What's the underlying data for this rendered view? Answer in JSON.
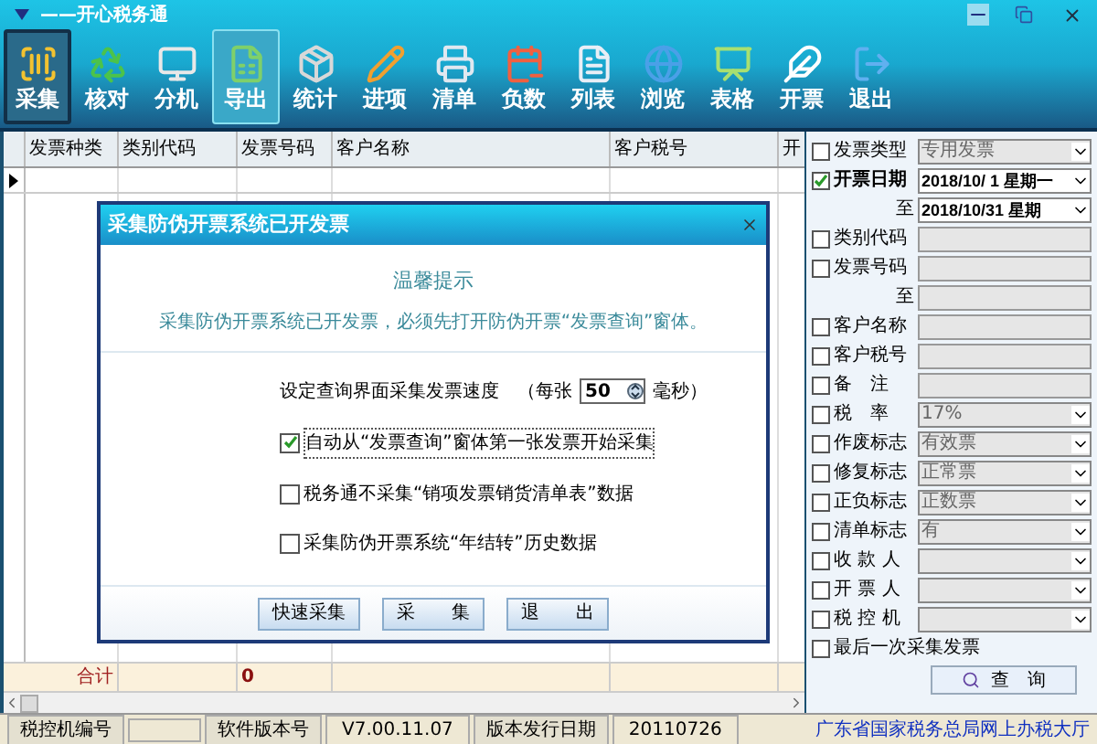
{
  "window": {
    "title": "——开心税务通"
  },
  "toolbar": [
    {
      "label": "采集",
      "selected": true,
      "hovered": false
    },
    {
      "label": "核对",
      "selected": false,
      "hovered": false
    },
    {
      "label": "分机",
      "selected": false,
      "hovered": false
    },
    {
      "label": "导出",
      "selected": false,
      "hovered": true
    },
    {
      "label": "统计",
      "selected": false,
      "hovered": false
    },
    {
      "label": "进项",
      "selected": false,
      "hovered": false
    },
    {
      "label": "清单",
      "selected": false,
      "hovered": false
    },
    {
      "label": "负数",
      "selected": false,
      "hovered": false
    },
    {
      "label": "列表",
      "selected": false,
      "hovered": false
    },
    {
      "label": "浏览",
      "selected": false,
      "hovered": false
    },
    {
      "label": "表格",
      "selected": false,
      "hovered": false
    },
    {
      "label": "开票",
      "selected": false,
      "hovered": false
    },
    {
      "label": "退出",
      "selected": false,
      "hovered": false
    }
  ],
  "table": {
    "columns": [
      "发票种类",
      "类别代码",
      "发票号码",
      "客户名称",
      "客户税号",
      "开"
    ],
    "totals": {
      "label": "合计",
      "count": "0"
    }
  },
  "dialog": {
    "title": "采集防伪开票系统已开发票",
    "heading": "温馨提示",
    "message": "采集防伪开票系统已开发票，必须先打开防伪开票“发票查询”窗体。",
    "speed": {
      "label": "设定查询界面采集发票速度",
      "before": "（每张",
      "value": "50",
      "after": "毫秒）"
    },
    "options": [
      {
        "label": "自动从“发票查询”窗体第一张发票开始采集",
        "checked": true
      },
      {
        "label": "税务通不采集“销项发票销货清单表”数据",
        "checked": false
      },
      {
        "label": "采集防伪开票系统“年结转”历史数据",
        "checked": false
      }
    ],
    "buttons": [
      "快速采集",
      "采　　集",
      "退　　出"
    ]
  },
  "filters": [
    {
      "kind": "dropdown",
      "label": "发票类型",
      "checked": false,
      "value": "专用发票"
    },
    {
      "kind": "date",
      "label": "开票日期",
      "checked": true,
      "value": "2018/10/ 1 星期一"
    },
    {
      "kind": "date",
      "label": "至",
      "value": "2018/10/31 星期"
    },
    {
      "kind": "text",
      "label": "类别代码",
      "checked": false
    },
    {
      "kind": "text",
      "label": "发票号码",
      "checked": false
    },
    {
      "kind": "text",
      "label": "至"
    },
    {
      "kind": "text",
      "label": "客户名称",
      "checked": false
    },
    {
      "kind": "text",
      "label": "客户税号",
      "checked": false
    },
    {
      "kind": "text",
      "label": "备　注",
      "checked": false
    },
    {
      "kind": "dropdown",
      "label": "税　率",
      "checked": false,
      "value": "17%"
    },
    {
      "kind": "dropdown",
      "label": "作废标志",
      "checked": false,
      "value": "有效票"
    },
    {
      "kind": "dropdown",
      "label": "修复标志",
      "checked": false,
      "value": "正常票"
    },
    {
      "kind": "dropdown",
      "label": "正负标志",
      "checked": false,
      "value": "正数票"
    },
    {
      "kind": "dropdown",
      "label": "清单标志",
      "checked": false,
      "value": "有"
    },
    {
      "kind": "dropdown",
      "label": "收 款 人",
      "checked": false
    },
    {
      "kind": "dropdown",
      "label": "开 票 人",
      "checked": false
    },
    {
      "kind": "dropdown",
      "label": "税 控 机",
      "checked": false
    },
    {
      "kind": "check",
      "label": "最后一次采集发票",
      "checked": false
    }
  ],
  "query_button": "查　询",
  "status_bar": [
    {
      "kind": "label",
      "text": "税控机编号"
    },
    {
      "kind": "value"
    },
    {
      "kind": "label",
      "text": "软件版本号"
    },
    {
      "kind": "value",
      "text": "V7.00.11.07"
    },
    {
      "kind": "label",
      "text": "版本发行日期"
    },
    {
      "kind": "value",
      "text": "20110726"
    },
    {
      "kind": "link",
      "text": "广东省国家税务总局网上办税大厅"
    }
  ]
}
